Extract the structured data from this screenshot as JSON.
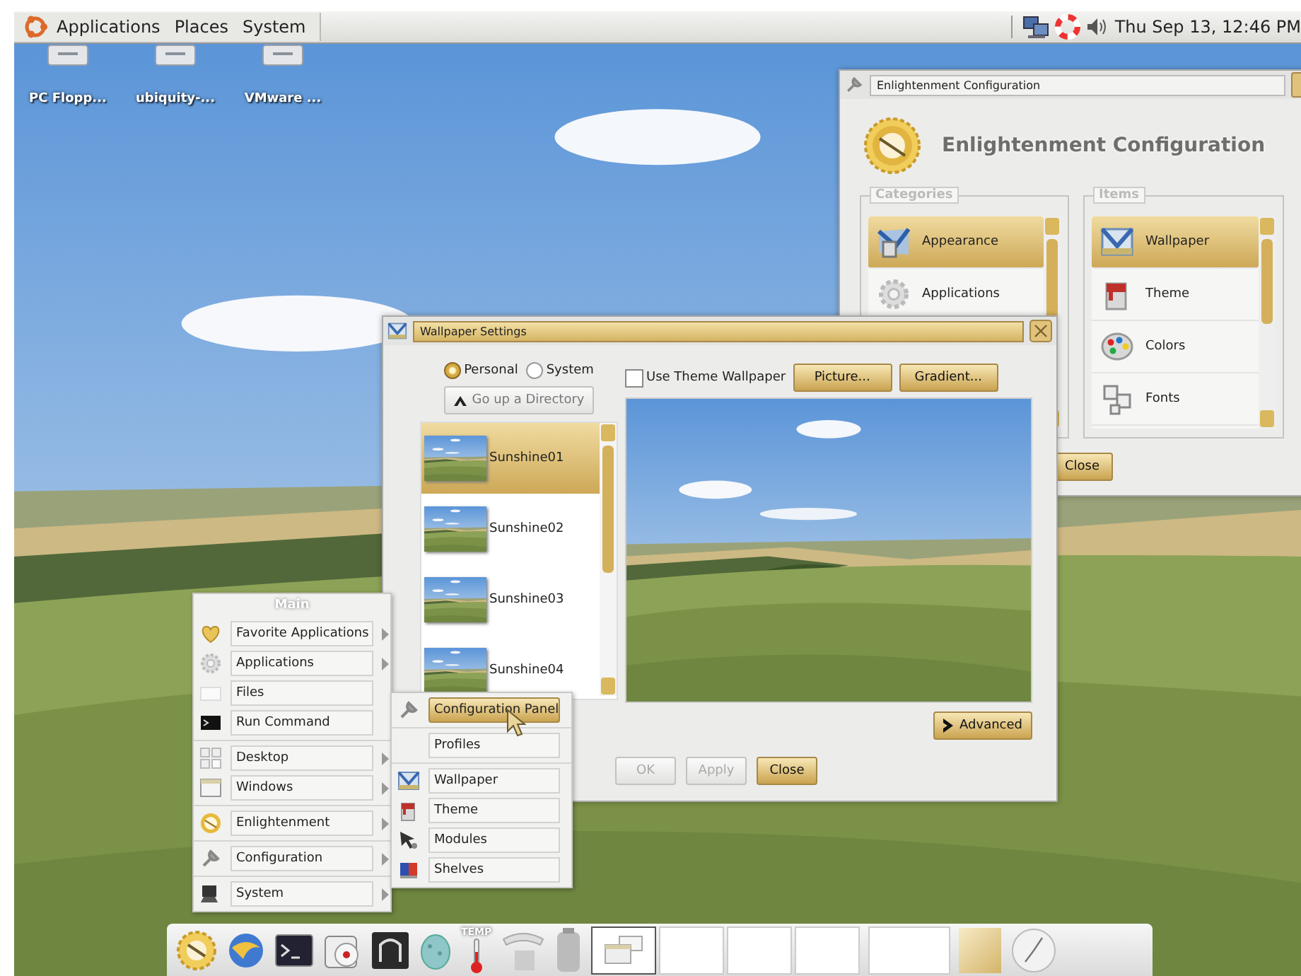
{
  "top_panel": {
    "menus": [
      {
        "label": "Applications"
      },
      {
        "label": "Places"
      },
      {
        "label": "System"
      }
    ],
    "clock": "Thu Sep 13, 12:46 PM"
  },
  "desktop_icons": [
    {
      "label": "PC Flopp..."
    },
    {
      "label": "ubiquity-..."
    },
    {
      "label": "VMware ..."
    }
  ],
  "config_window": {
    "title": "Enlightenment Configuration",
    "heading": "Enlightenment Configuration",
    "categories": {
      "label": "Categories",
      "items": [
        {
          "label": "Appearance",
          "selected": true
        },
        {
          "label": "Applications",
          "selected": false
        }
      ]
    },
    "items": {
      "label": "Items",
      "items": [
        {
          "label": "Wallpaper",
          "selected": true
        },
        {
          "label": "Theme",
          "selected": false
        },
        {
          "label": "Colors",
          "selected": false
        },
        {
          "label": "Fonts",
          "selected": false
        }
      ]
    },
    "close_button": "Close"
  },
  "wallpaper_window": {
    "title": "Wallpaper Settings",
    "sources": [
      {
        "label": "Personal",
        "selected": true
      },
      {
        "label": "System",
        "selected": false
      }
    ],
    "up_button": "Go up a Directory",
    "use_theme": {
      "label": "Use Theme Wallpaper",
      "checked": false
    },
    "tool_buttons": [
      {
        "label": "Picture..."
      },
      {
        "label": "Gradient..."
      }
    ],
    "files": [
      {
        "name": "Sunshine01",
        "selected": true
      },
      {
        "name": "Sunshine02",
        "selected": false
      },
      {
        "name": "Sunshine03",
        "selected": false
      },
      {
        "name": "Sunshine04",
        "selected": false
      }
    ],
    "advanced_button": "Advanced",
    "footer_buttons": [
      {
        "label": "OK",
        "disabled": true
      },
      {
        "label": "Apply",
        "disabled": true
      },
      {
        "label": "Close",
        "disabled": false
      }
    ]
  },
  "main_menu": {
    "title": "Main",
    "sections": [
      [
        {
          "label": "Favorite Applications",
          "submenu": true
        },
        {
          "label": "Applications",
          "submenu": true
        },
        {
          "label": "Files",
          "submenu": false
        },
        {
          "label": "Run Command",
          "submenu": false
        }
      ],
      [
        {
          "label": "Desktop",
          "submenu": true
        },
        {
          "label": "Windows",
          "submenu": true
        }
      ],
      [
        {
          "label": "Enlightenment",
          "submenu": true
        }
      ],
      [
        {
          "label": "Configuration",
          "submenu": true
        }
      ],
      [
        {
          "label": "System",
          "submenu": true
        }
      ]
    ]
  },
  "sub_menu": {
    "sections": [
      [
        {
          "label": "Configuration Panel",
          "selected": true
        }
      ],
      [
        {
          "label": "Profiles",
          "selected": false
        }
      ],
      [
        {
          "label": "Wallpaper",
          "selected": false
        },
        {
          "label": "Theme",
          "selected": false
        },
        {
          "label": "Modules",
          "selected": false
        },
        {
          "label": "Shelves",
          "selected": false
        }
      ]
    ]
  },
  "dock": {
    "temp_label": "TEMP"
  }
}
